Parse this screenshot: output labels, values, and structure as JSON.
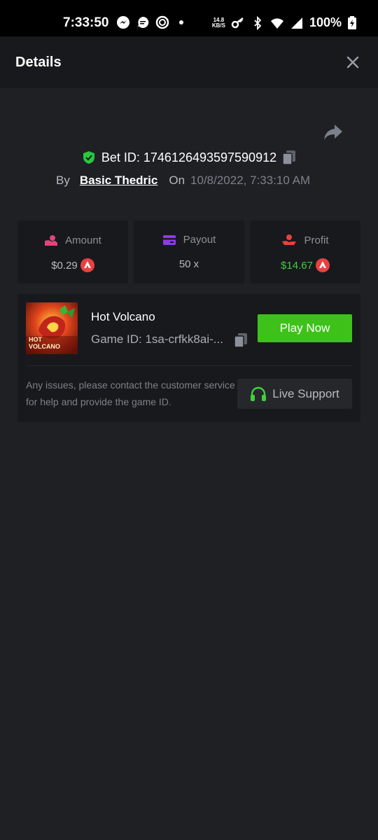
{
  "status_bar": {
    "time": "7:33:50",
    "speed_value": "14.8",
    "speed_unit": "KB/S",
    "battery": "100%"
  },
  "header": {
    "title": "Details",
    "close_icon": "close-icon"
  },
  "bet": {
    "id_label": "Bet ID: 1746126493597590912",
    "by_label": "By",
    "user": "Basic Thedric",
    "on_label": "On",
    "date": "10/8/2022, 7:33:10 AM"
  },
  "stats": [
    {
      "label": "Amount",
      "value": "$0.29",
      "icon": "amount-icon",
      "color": "#e0457a"
    },
    {
      "label": "Payout",
      "value": "50 x",
      "icon": "card-icon",
      "color": "#8b3bf0"
    },
    {
      "label": "Profit",
      "value": "$14.67",
      "icon": "profit-icon",
      "color": "#e8413f"
    }
  ],
  "game": {
    "name": "Hot Volcano",
    "id_text": "Game ID: 1sa-crfkk8ai-...",
    "thumb_title_line1": "HOT",
    "thumb_title_line2": "VOLCANO",
    "play_label": "Play Now",
    "issues_text": "Any issues, please contact the customer service for help and provide the game ID.",
    "support_label": "Live Support"
  },
  "colors": {
    "background": "#1f2024",
    "card": "#18191c",
    "accent_green": "#3ec21a",
    "profit_green": "#3fcf3c",
    "shield_green": "#28c840",
    "avax_red": "#e84142"
  }
}
